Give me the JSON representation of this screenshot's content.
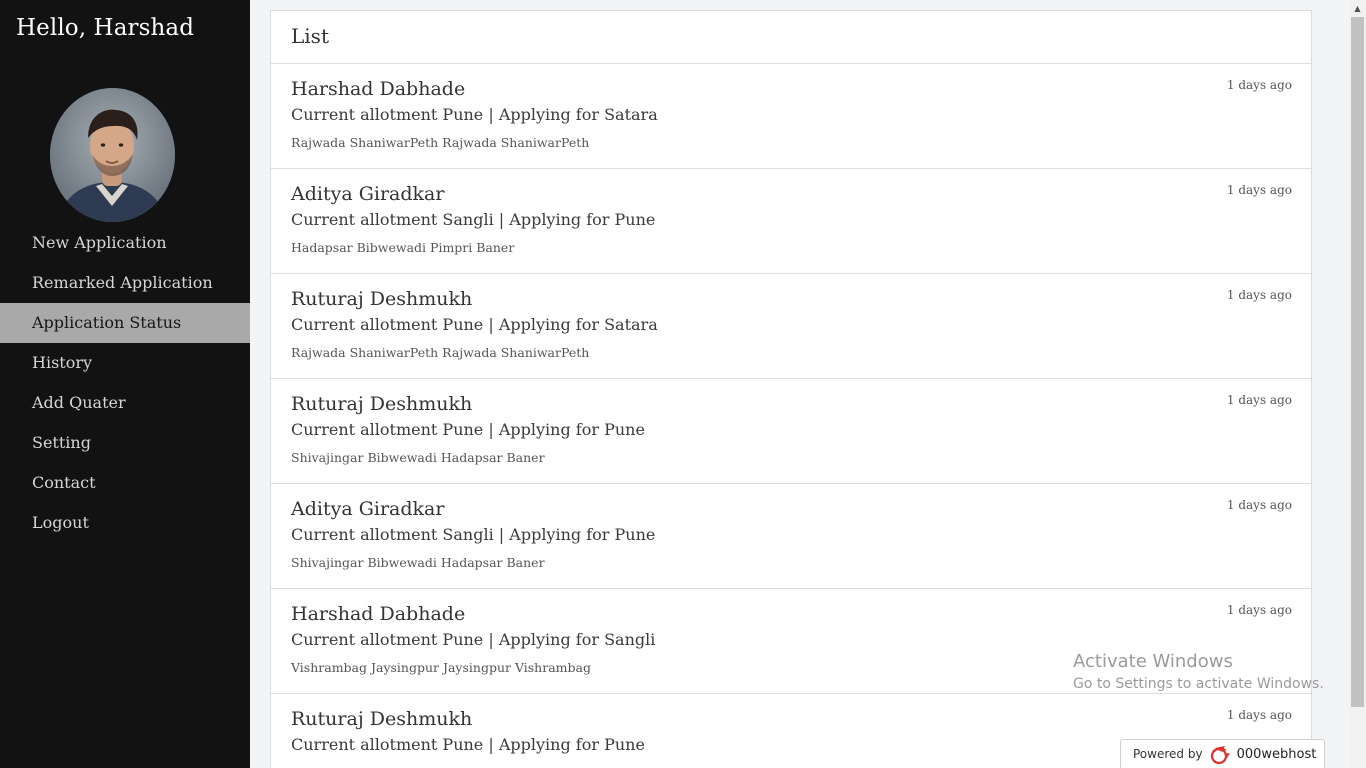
{
  "sidebar": {
    "greeting": "Hello, Harshad",
    "avatar_icon": "user-avatar-photo",
    "nav": [
      {
        "label": "New Application"
      },
      {
        "label": "Remarked Application"
      },
      {
        "label": "Application Status",
        "active": true
      },
      {
        "label": "History"
      },
      {
        "label": "Add Quater"
      },
      {
        "label": "Setting"
      },
      {
        "label": "Contact"
      },
      {
        "label": "Logout"
      }
    ]
  },
  "main": {
    "title": "List",
    "entries": [
      {
        "name": "Harshad Dabhade",
        "allotment": "Current allotment Pune | Applying for Satara",
        "areas": "Rajwada ShaniwarPeth Rajwada ShaniwarPeth",
        "time": "1 days ago"
      },
      {
        "name": "Aditya Giradkar",
        "allotment": "Current allotment Sangli | Applying for Pune",
        "areas": "Hadapsar Bibwewadi Pimpri Baner",
        "time": "1 days ago"
      },
      {
        "name": "Ruturaj Deshmukh",
        "allotment": "Current allotment Pune | Applying for Satara",
        "areas": "Rajwada ShaniwarPeth Rajwada ShaniwarPeth",
        "time": "1 days ago"
      },
      {
        "name": "Ruturaj Deshmukh",
        "allotment": "Current allotment Pune | Applying for Pune",
        "areas": "Shivajingar Bibwewadi Hadapsar Baner",
        "time": "1 days ago"
      },
      {
        "name": "Aditya Giradkar",
        "allotment": "Current allotment Sangli | Applying for Pune",
        "areas": "Shivajingar Bibwewadi Hadapsar Baner",
        "time": "1 days ago"
      },
      {
        "name": "Harshad Dabhade",
        "allotment": "Current allotment Pune | Applying for Sangli",
        "areas": "Vishrambag Jaysingpur Jaysingpur Vishrambag",
        "time": "1 days ago"
      },
      {
        "name": "Ruturaj Deshmukh",
        "allotment": "Current allotment Pune | Applying for Pune",
        "areas": "",
        "time": "1 days ago"
      }
    ]
  },
  "watermark": {
    "title": "Activate Windows",
    "subtitle": "Go to Settings to activate Windows."
  },
  "powered": {
    "label": "Powered by",
    "brand": "000webhost",
    "logo_icon": "000webhost-logo-icon"
  },
  "colors": {
    "sidebar_bg": "#121212",
    "active_nav_bg": "#a9a9a9",
    "page_bg": "#f3f4f6",
    "brand_red": "#e0312c"
  }
}
